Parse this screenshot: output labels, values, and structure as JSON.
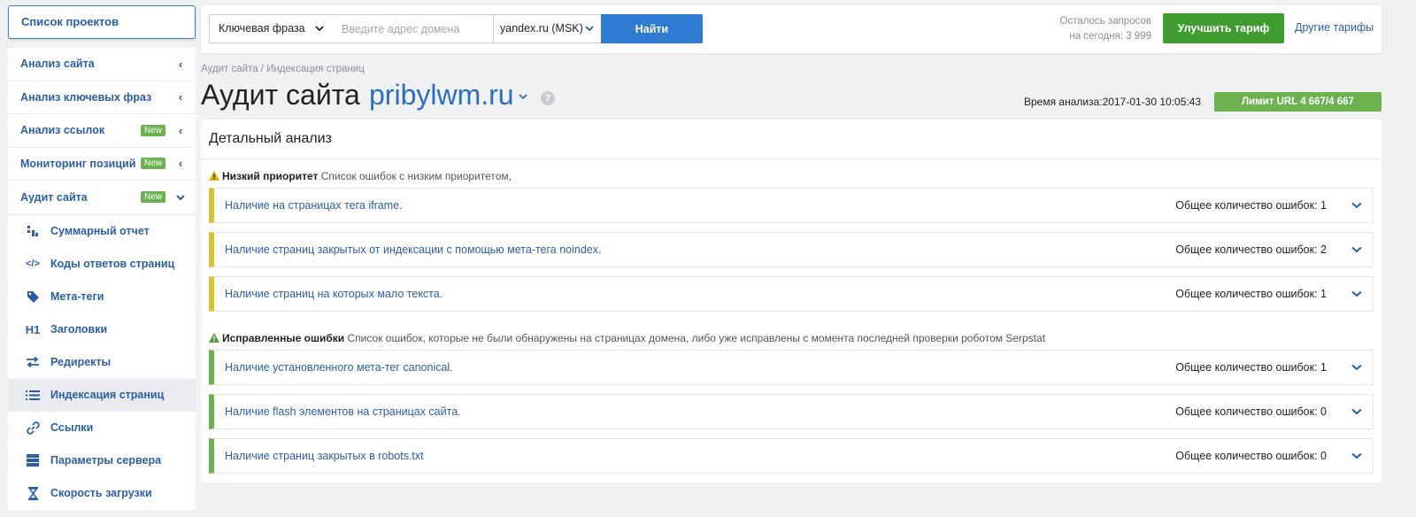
{
  "sidebar": {
    "projects_label": "Список проектов",
    "menu": [
      {
        "label": "Анализ сайта",
        "badge": "",
        "chevron": "‹"
      },
      {
        "label": "Анализ ключевых фраз",
        "badge": "",
        "chevron": "‹"
      },
      {
        "label": "Анализ ссылок",
        "badge": "New",
        "chevron": "‹"
      },
      {
        "label": "Мониторинг позиций",
        "badge": "New",
        "chevron": "‹"
      },
      {
        "label": "Аудит сайта",
        "badge": "New",
        "chevron": "⌄"
      }
    ],
    "submenu": [
      {
        "label": "Суммарный отчет",
        "icon": "bar-chart-icon",
        "icon_glyph": "▐▌"
      },
      {
        "label": "Коды ответов страниц",
        "icon": "code-icon",
        "icon_glyph": "</>"
      },
      {
        "label": "Мета-теги",
        "icon": "tag-icon",
        "icon_glyph": "◆"
      },
      {
        "label": "Заголовки",
        "icon": "heading-icon",
        "icon_glyph": "H1"
      },
      {
        "label": "Редиректы",
        "icon": "redirect-icon",
        "icon_glyph": "⇆"
      },
      {
        "label": "Индексация страниц",
        "icon": "list-icon",
        "icon_glyph": "☰",
        "active": true
      },
      {
        "label": "Ссылки",
        "icon": "link-icon",
        "icon_glyph": "🔗"
      },
      {
        "label": "Параметры сервера",
        "icon": "server-icon",
        "icon_glyph": "☰"
      },
      {
        "label": "Скорость загрузки",
        "icon": "hourglass-icon",
        "icon_glyph": "⌛"
      }
    ]
  },
  "topbar": {
    "search_type": "Ключевая фраза",
    "domain_placeholder": "Введите адрес домена",
    "database": "yandex.ru (MSK)",
    "find_label": "Найти",
    "quota_line1": "Осталось запросов",
    "quota_line2": "на сегодня: 3 999",
    "upgrade_label": "Улучшить тариф",
    "other_tariffs": "Другие тарифы"
  },
  "header": {
    "breadcrumb": "Аудит сайта / Индексация страниц",
    "title": "Аудит сайта",
    "domain": "pribylwm.ru",
    "analysis_time": "Время анализа:2017-01-30 10:05:43",
    "limit": "Лимит URL 4 667/4 667"
  },
  "panel": {
    "title": "Детальный анализ",
    "low_priority": {
      "heading": "Низкий приоритет",
      "description": "Список ошибок с низким приоритетом,",
      "rows": [
        {
          "title": "Наличие на страницах тега iframe.",
          "count": "Общее количество ошибок: 1"
        },
        {
          "title": "Наличие страниц закрытых от индексации с помощью мета-тега noindex.",
          "count": "Общее количество ошибок: 2"
        },
        {
          "title": "Наличие страниц на которых мало текста.",
          "count": "Общее количество ошибок: 1"
        }
      ]
    },
    "fixed": {
      "heading": "Исправленные ошибки",
      "description": "Список ошибок, которые не были обнаружены на страницах домена, либо уже исправлены с момента последней проверки роботом Serpstat",
      "rows": [
        {
          "title": "Наличие установленного мета-тег canonical.",
          "count": "Общее количество ошибок: 1"
        },
        {
          "title": "Наличие flash элементов на страницах сайта.",
          "count": "Общее количество ошибок: 0"
        },
        {
          "title": "Наличие страниц закрытых в robots.txt",
          "count": "Общее количество ошибок: 0"
        }
      ]
    }
  },
  "colors": {
    "accent": "#2a5fa8",
    "warning": "#d9c330",
    "success": "#6cb350",
    "upgrade": "#3f9c2e"
  }
}
